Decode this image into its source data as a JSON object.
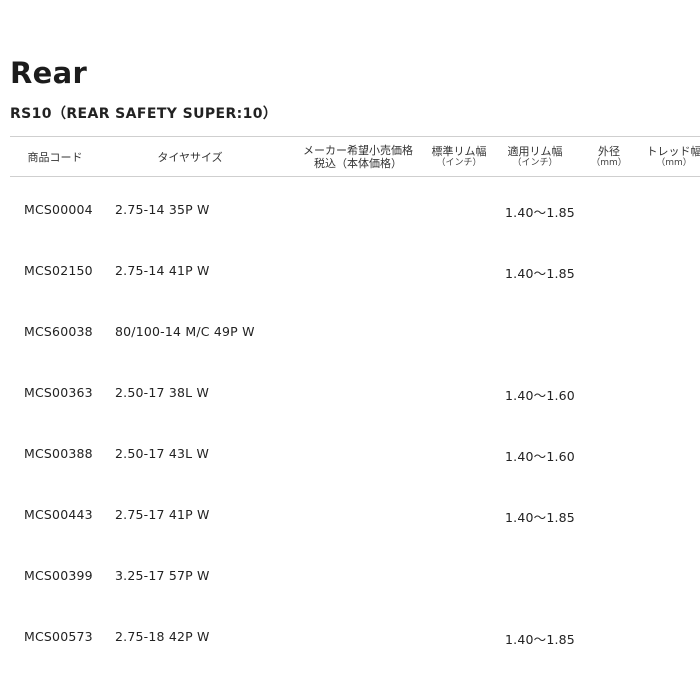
{
  "page": {
    "title": "Rear",
    "subtitle": "RS10（REAR SAFETY SUPER:10）"
  },
  "table": {
    "headers": {
      "code": "商品コード",
      "size": "タイヤサイズ",
      "price_l1": "メーカー希望小売価格",
      "price_l2": "税込（本体価格）",
      "std_rim_l1": "標準リム幅",
      "std_rim_l2": "（インチ）",
      "app_rim_l1": "適用リム幅",
      "app_rim_l2": "（インチ）",
      "diameter_l1": "外径",
      "diameter_l2": "（mm）",
      "tread_l1": "トレッド幅",
      "tread_l2": "（mm）"
    },
    "rows": [
      {
        "code": "MCS00004",
        "size": "2.75-14 35P W",
        "app_rim": "1.40〜1.85"
      },
      {
        "code": "MCS02150",
        "size": "2.75-14 41P W",
        "app_rim": "1.40〜1.85"
      },
      {
        "code": "MCS60038",
        "size": "80/100-14 M/C 49P W",
        "app_rim": ""
      },
      {
        "code": "MCS00363",
        "size": "2.50-17 38L W",
        "app_rim": "1.40〜1.60"
      },
      {
        "code": "MCS00388",
        "size": "2.50-17 43L W",
        "app_rim": "1.40〜1.60"
      },
      {
        "code": "MCS00443",
        "size": "2.75-17 41P W",
        "app_rim": "1.40〜1.85"
      },
      {
        "code": "MCS00399",
        "size": "3.25-17 57P W",
        "app_rim": ""
      },
      {
        "code": "MCS00573",
        "size": "2.75-18 42P W",
        "app_rim": "1.40〜1.85"
      }
    ]
  }
}
